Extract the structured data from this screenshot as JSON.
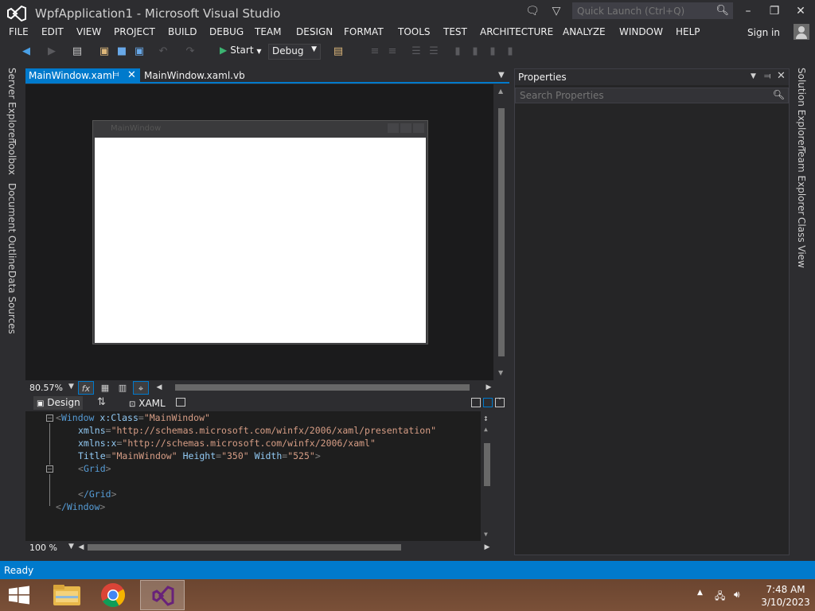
{
  "window": {
    "title": "WpfApplication1 - Microsoft Visual Studio",
    "quick_launch_placeholder": "Quick Launch (Ctrl+Q)",
    "sign_in": "Sign in"
  },
  "menu": [
    "FILE",
    "EDIT",
    "VIEW",
    "PROJECT",
    "BUILD",
    "DEBUG",
    "TEAM",
    "DESIGN",
    "FORMAT",
    "TOOLS",
    "TEST",
    "ARCHITECTURE",
    "ANALYZE",
    "WINDOW",
    "HELP"
  ],
  "toolbar": {
    "start_label": "Start",
    "configuration": "Debug"
  },
  "left_tabs": [
    "Server Explorer",
    "Toolbox",
    "Document Outline",
    "Data Sources"
  ],
  "right_tabs": [
    "Solution Explorer",
    "Team Explorer",
    "Class View"
  ],
  "doc_tabs": {
    "active": "MainWindow.xaml",
    "other": "MainWindow.xaml.vb"
  },
  "designer": {
    "window_title": "MainWindow",
    "zoom": "80.57%",
    "fx_label": "fx"
  },
  "split_tabs": {
    "design": "Design",
    "xaml": "XAML"
  },
  "xaml": {
    "line1_tag": "Window",
    "line1_attr": "x:Class",
    "line1_val": "\"MainWindow\"",
    "line2_attr": "xmlns",
    "line2_val": "\"http://schemas.microsoft.com/winfx/2006/xaml/presentation\"",
    "line3_attr": "xmlns:x",
    "line3_val": "\"http://schemas.microsoft.com/winfx/2006/xaml\"",
    "line4_title_attr": "Title",
    "line4_title_val": "\"MainWindow\"",
    "line4_height_attr": "Height",
    "line4_height_val": "\"350\"",
    "line4_width_attr": "Width",
    "line4_width_val": "\"525\"",
    "grid_tag": "Grid",
    "grid_close": "/Grid",
    "window_close": "/Window"
  },
  "editor_zoom": "100 %",
  "properties": {
    "title": "Properties",
    "search_placeholder": "Search Properties"
  },
  "status": "Ready",
  "clock": {
    "time": "7:48 AM",
    "date": "3/10/2023"
  },
  "colors": {
    "accent": "#007acc",
    "background": "#2d2d30",
    "vs_purple": "#68217a"
  }
}
